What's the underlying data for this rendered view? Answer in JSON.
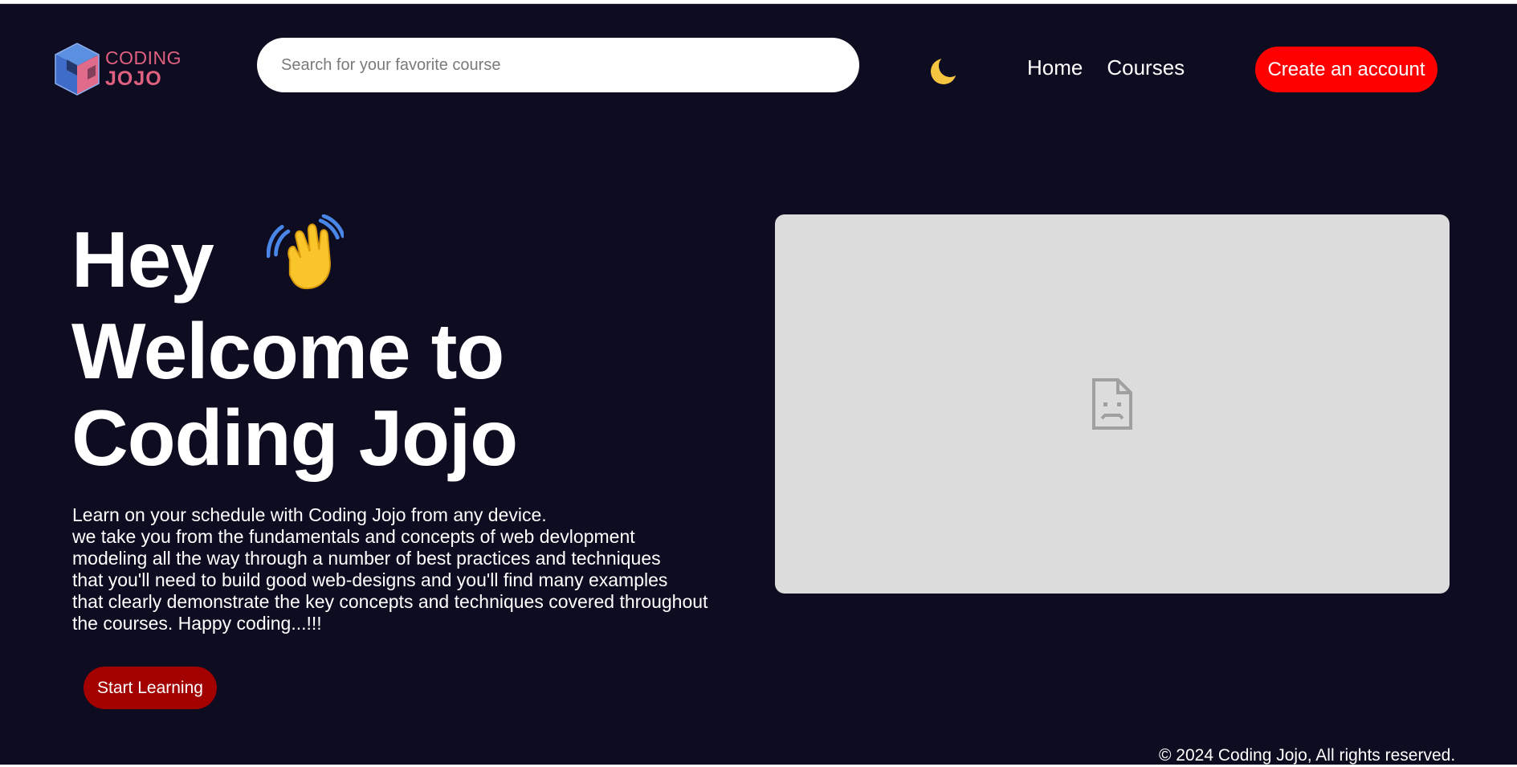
{
  "brand": {
    "line1": "CODING",
    "line2": "JOJO"
  },
  "search": {
    "placeholder": "Search for your favorite course",
    "value": ""
  },
  "theme_toggle": {
    "icon": "crescent-moon-icon",
    "glyph": "🌙"
  },
  "nav": {
    "items": [
      {
        "label": "Home"
      },
      {
        "label": "Courses"
      }
    ]
  },
  "header": {
    "cta_label": "Create an account"
  },
  "hero": {
    "title_line1": "Hey",
    "wave_emoji": "👋",
    "title_line2": "Welcome to",
    "title_line3": "Coding Jojo",
    "description_lines": [
      "Learn on your schedule with Coding Jojo from any device.",
      "we take you from the fundamentals and concepts of web devlopment",
      "modeling all the way through a number of best practices and techniques",
      "that you'll need to build good web-designs and you'll find many examples",
      "that clearly demonstrate the key concepts and techniques covered throughout",
      "the courses. Happy coding...!!!"
    ],
    "start_button_label": "Start Learning"
  },
  "media": {
    "icon": "broken-page-icon"
  },
  "footer": {
    "copyright": "© 2024 Coding Jojo, All rights reserved."
  },
  "colors": {
    "background": "#0d0c20",
    "accent": "#ff0000",
    "start_button": "#a30000",
    "brand_pink": "#e0607f",
    "media_placeholder": "#dcdcdc"
  }
}
